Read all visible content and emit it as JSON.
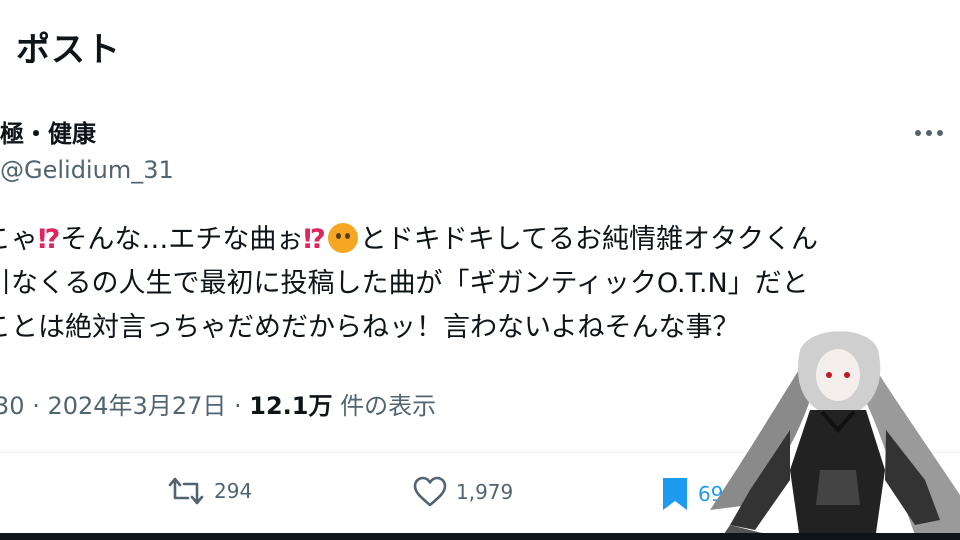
{
  "header": {
    "title": "ポスト"
  },
  "author": {
    "name": "極・健康",
    "handle": "@Gelidium_31"
  },
  "tweet": {
    "lines": [
      [
        "こゃ",
        "⁉",
        "そんな…エチな曲ぉ",
        "⁉",
        "とドキドキしてるお純情雑オタクくん"
      ],
      "引なくるの人生で最初に投稿した曲が「ギガンティックO.T.N」だと",
      "ことは絶対言っちゃだめだからねッ！言わないよねそんな事？"
    ]
  },
  "meta": {
    "time_fragment": "30",
    "date": "2024年3月27日",
    "views_count": "12.1万",
    "views_label": "件の表示",
    "separator": "·"
  },
  "actions": {
    "retweets": "294",
    "likes": "1,979",
    "bookmarks": "69"
  },
  "icons": {
    "more": "more-icon",
    "retweet": "retweet-icon",
    "like": "heart-icon",
    "bookmark": "bookmark-icon"
  },
  "colors": {
    "text": "#0f1419",
    "secondary": "#536471",
    "accent": "#1d9bf0",
    "emoji_red": "#e0245e"
  }
}
